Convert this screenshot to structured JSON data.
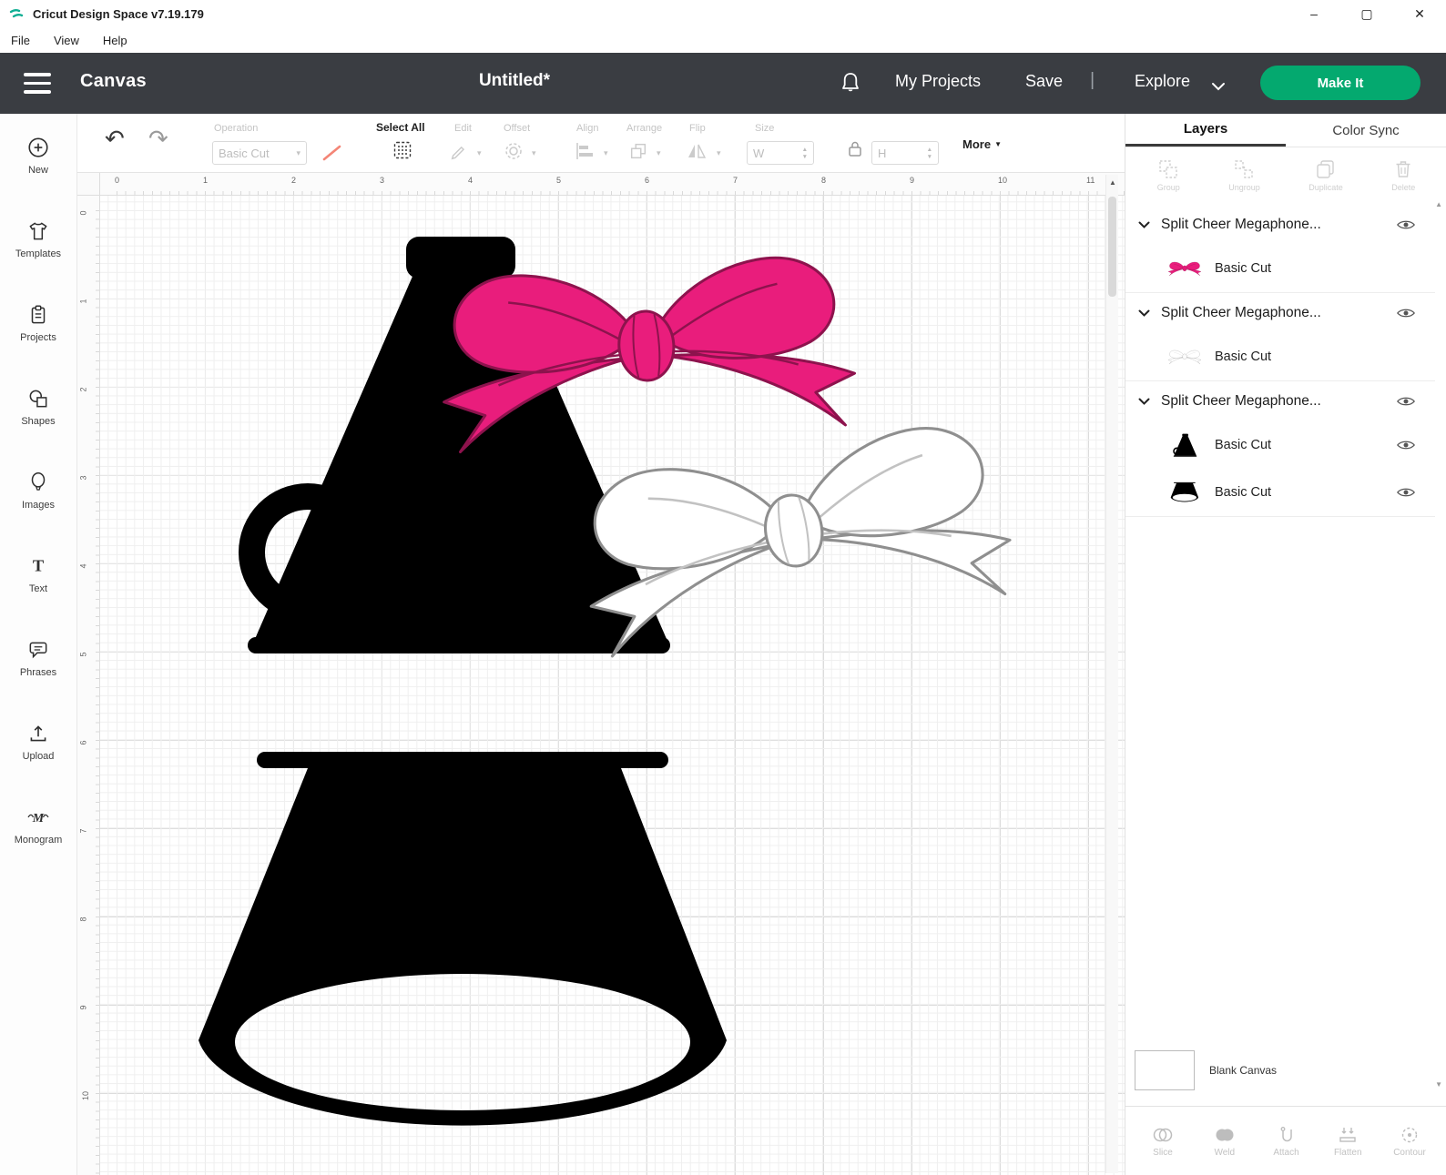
{
  "window": {
    "title": "Cricut Design Space  v7.19.179",
    "menu": [
      "File",
      "View",
      "Help"
    ],
    "controls": {
      "minimize": "–",
      "maximize": "▢",
      "close": "✕"
    }
  },
  "header": {
    "canvas_label": "Canvas",
    "doc_title": "Untitled*",
    "my_projects": "My Projects",
    "save": "Save",
    "divider": "|",
    "explore": "Explore",
    "make_it": "Make It"
  },
  "toolbar": {
    "operation_label": "Operation",
    "operation_value": "Basic Cut",
    "select_all": "Select All",
    "edit": "Edit",
    "offset": "Offset",
    "align": "Align",
    "arrange": "Arrange",
    "flip": "Flip",
    "size_label": "Size",
    "w_label": "W",
    "h_label": "H",
    "more": "More"
  },
  "sidebar": {
    "items": [
      {
        "label": "New"
      },
      {
        "label": "Templates"
      },
      {
        "label": "Projects"
      },
      {
        "label": "Shapes"
      },
      {
        "label": "Images"
      },
      {
        "label": "Text"
      },
      {
        "label": "Phrases"
      },
      {
        "label": "Upload"
      },
      {
        "label": "Monogram"
      }
    ]
  },
  "rulers": {
    "top": [
      "0",
      "1",
      "2",
      "3",
      "4",
      "5",
      "6",
      "7",
      "8",
      "9",
      "10",
      "11"
    ],
    "left": [
      "0",
      "1",
      "2",
      "3",
      "4",
      "5",
      "6",
      "7",
      "8",
      "9",
      "10"
    ]
  },
  "layers_panel": {
    "tabs": [
      "Layers",
      "Color Sync"
    ],
    "tools": [
      "Group",
      "Ungroup",
      "Duplicate",
      "Delete"
    ],
    "groups": [
      {
        "title": "Split Cheer Megaphone...",
        "layers": [
          {
            "label": "Basic Cut",
            "thumb": "pink-bow"
          }
        ]
      },
      {
        "title": "Split Cheer Megaphone...",
        "layers": [
          {
            "label": "Basic Cut",
            "thumb": "white-bow"
          }
        ]
      },
      {
        "title": "Split Cheer Megaphone...",
        "layers": [
          {
            "label": "Basic Cut",
            "thumb": "megaphone-top"
          },
          {
            "label": "Basic Cut",
            "thumb": "megaphone-bottom"
          }
        ]
      }
    ],
    "blank_canvas": "Blank Canvas",
    "bottom_tools": [
      "Slice",
      "Weld",
      "Attach",
      "Flatten",
      "Contour"
    ]
  },
  "colors": {
    "accent_green": "#04a96f",
    "pink": "#e91d7c",
    "pink_outline": "#8d134d",
    "header_bg": "#3a3d42",
    "disabled_icon": "#c9c9c9",
    "coral_swatch": "#f48576"
  }
}
